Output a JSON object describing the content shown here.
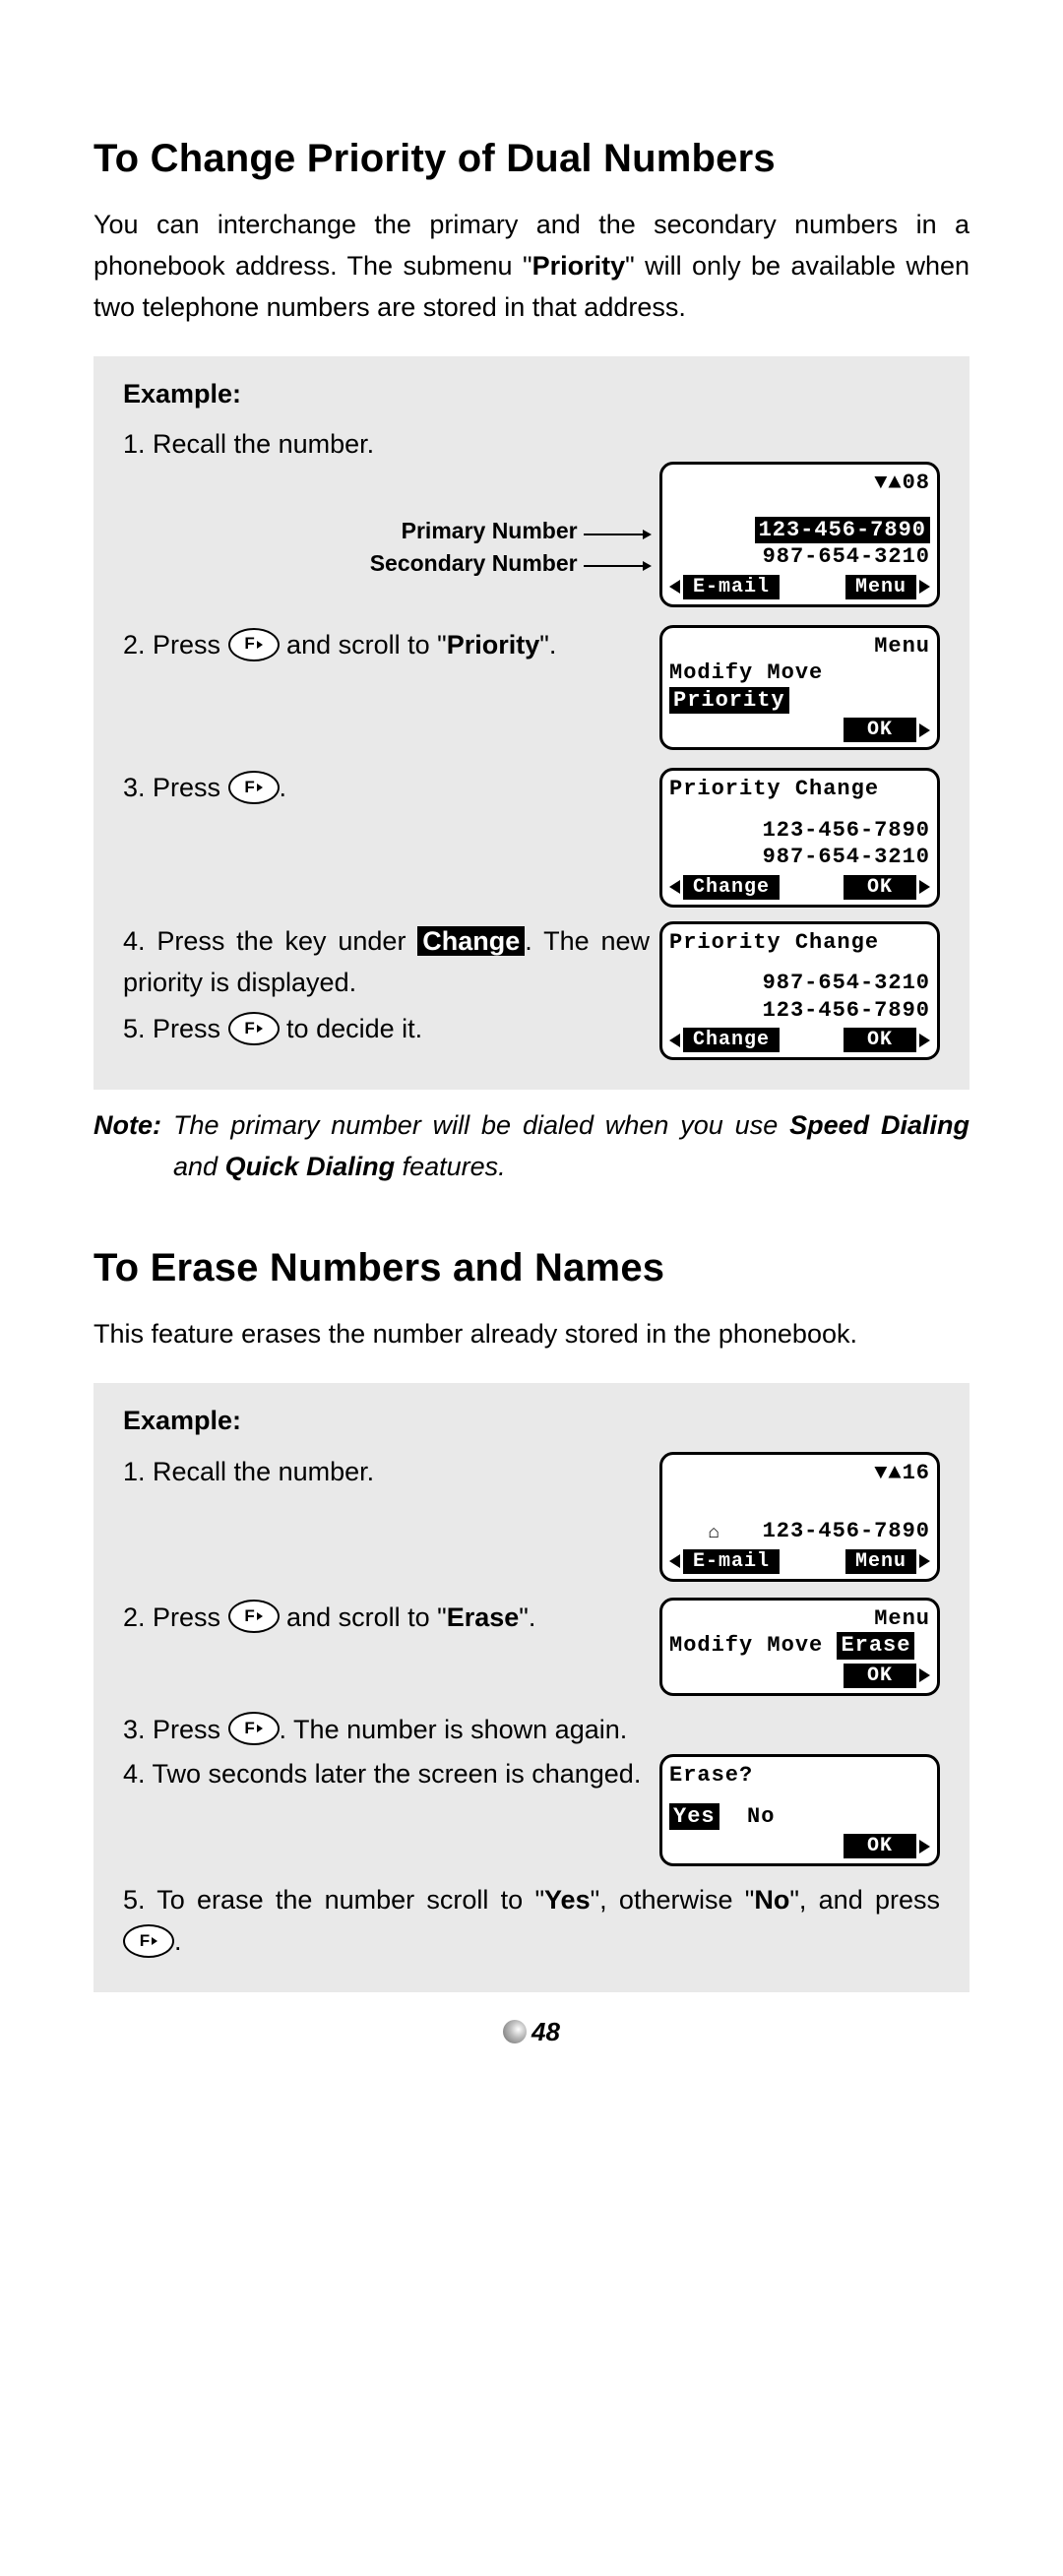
{
  "page_number": "48",
  "section1": {
    "heading": "To Change Priority of Dual Numbers",
    "intro_parts": {
      "a": "You can interchange the primary and the secondary numbers in a phonebook address. The submenu \"",
      "b": "Priority",
      "c": "\" will only be available when two telephone numbers are stored in that address."
    },
    "example_label": "Example:",
    "labels": {
      "primary": "Primary Number",
      "secondary": "Secondary Number"
    },
    "steps": {
      "s1": "1. Recall the number.",
      "s2a": "2. Press ",
      "s2b": " and scroll to \"",
      "s2c": "Priority",
      "s2d": "\".",
      "s3a": "3. Press ",
      "s3b": ".",
      "s4a": "4. Press the key under ",
      "s4b": "Change",
      "s4c": ". The new priority is displayed.",
      "s5a": "5. Press ",
      "s5b": " to decide it."
    },
    "screens": {
      "scr1": {
        "header": "▼▲08",
        "primary": "123-456-7890",
        "secondary": "987-654-3210",
        "sk_left": "E-mail",
        "sk_right": "Menu"
      },
      "scr2": {
        "title": "Menu",
        "item1": "Modify",
        "item2": "Move",
        "item3_sel": "Priority",
        "sk_right": "OK"
      },
      "scr3": {
        "title": "Priority Change",
        "line1": "123-456-7890",
        "line2": "987-654-3210",
        "sk_left": "Change",
        "sk_right": "OK"
      },
      "scr4": {
        "title": "Priority Change",
        "line1": "987-654-3210",
        "line2": "123-456-7890",
        "sk_left": "Change",
        "sk_right": "OK"
      }
    },
    "note": {
      "label": "Note:",
      "a": "The primary number will be dialed when you use ",
      "b": "Speed Dialing",
      "c": " and ",
      "d": "Quick Dialing",
      "e": " features."
    }
  },
  "section2": {
    "heading": "To Erase Numbers and Names",
    "intro": "This feature erases the number already stored in the phonebook.",
    "example_label": "Example:",
    "steps": {
      "s1": "1. Recall the number.",
      "s2a": "2. Press ",
      "s2b": " and scroll to \"",
      "s2c": "Erase",
      "s2d": "\".",
      "s3a": "3. Press ",
      "s3b": ". The number is shown again.",
      "s4": "4. Two seconds later the screen is changed.",
      "s5a": "5. To erase the number scroll to \"",
      "s5b": "Yes",
      "s5c": "\", otherwise \"",
      "s5d": "No",
      "s5e": "\", and press ",
      "s5f": "."
    },
    "screens": {
      "scr1": {
        "header": "▼▲16",
        "number": "123-456-7890",
        "sk_left": "E-mail",
        "sk_right": "Menu"
      },
      "scr2": {
        "title": "Menu",
        "item1": "Modify",
        "item2": "Move",
        "item3_sel": "Erase",
        "sk_right": "OK"
      },
      "scr3": {
        "title": "Erase?",
        "opt1_sel": "Yes",
        "opt2": "No",
        "sk_right": "OK"
      }
    }
  }
}
